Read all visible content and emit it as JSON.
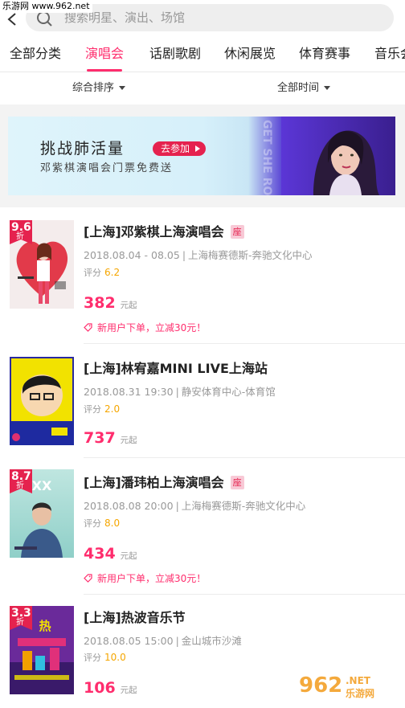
{
  "watermark": "乐游网 www.962.net",
  "search": {
    "placeholder": "搜索明星、演出、场馆"
  },
  "tabs": [
    {
      "label": "全部分类",
      "active": false
    },
    {
      "label": "演唱会",
      "active": true
    },
    {
      "label": "话剧歌剧",
      "active": false
    },
    {
      "label": "休闲展览",
      "active": false
    },
    {
      "label": "体育赛事",
      "active": false
    },
    {
      "label": "音乐会",
      "active": false
    }
  ],
  "filters": {
    "sort": "综合排序",
    "time": "全部时间"
  },
  "banner": {
    "title": "挑战肺活量",
    "join_label": "去参加",
    "subtitle": "邓紫棋演唱会门票免费送",
    "overlay_text": "GET SHE RONG MOVING"
  },
  "colors": {
    "accent": "#ff2d6d",
    "score": "#f5a600",
    "badge": "#e5224e"
  },
  "events": [
    {
      "name": "[上海]邓紫棋上海演唱会",
      "seat_badge": "座",
      "date": "2018.08.04 - 08.05",
      "venue": "上海梅赛德斯-奔驰文化中心",
      "score_label": "评分",
      "score": "6.2",
      "price": "382",
      "price_unit": "元起",
      "discount": {
        "num": "9.6",
        "unit": "折"
      },
      "promo": "新用户下单，立减30元！"
    },
    {
      "name": "[上海]林宥嘉MINI LIVE上海站",
      "seat_badge": "",
      "date": "2018.08.31 19:30",
      "venue": "静安体育中心-体育馆",
      "score_label": "评分",
      "score": "2.0",
      "price": "737",
      "price_unit": "元起",
      "discount": null,
      "promo": ""
    },
    {
      "name": "[上海]潘玮柏上海演唱会",
      "seat_badge": "座",
      "date": "2018.08.08 20:00",
      "venue": "上海梅赛德斯-奔驰文化中心",
      "score_label": "评分",
      "score": "8.0",
      "price": "434",
      "price_unit": "元起",
      "discount": {
        "num": "8.7",
        "unit": "折"
      },
      "promo": "新用户下单，立减30元！"
    },
    {
      "name": "[上海]热波音乐节",
      "seat_badge": "",
      "date": "2018.08.05 15:00",
      "venue": "金山城市沙滩",
      "score_label": "评分",
      "score": "10.0",
      "price": "106",
      "price_unit": "元起",
      "discount": {
        "num": "3.3",
        "unit": "折"
      },
      "promo": ""
    }
  ]
}
